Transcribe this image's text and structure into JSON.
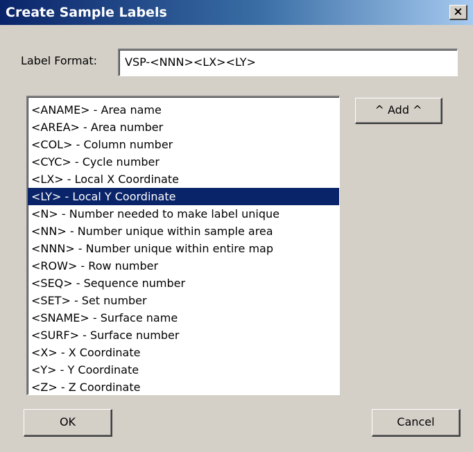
{
  "window": {
    "title": "Create Sample Labels",
    "close_glyph": "×",
    "close_icon": "close-icon"
  },
  "label_format": {
    "label": "Label Format:",
    "value": "VSP-<NNN><LX><LY>"
  },
  "token_list": {
    "selected_index": 5,
    "items": [
      "<ANAME> - Area name",
      "<AREA> - Area number",
      "<COL> - Column number",
      "<CYC> - Cycle number",
      "<LX> - Local X Coordinate",
      "<LY> - Local Y Coordinate",
      "<N> - Number needed to make label unique",
      "<NN> - Number unique within sample area",
      "<NNN> - Number unique within entire map",
      "<ROW> - Row number",
      "<SEQ> - Sequence number",
      "<SET> - Set number",
      "<SNAME> - Surface name",
      "<SURF> - Surface number",
      "<X> - X Coordinate",
      "<Y> - Y Coordinate",
      "<Z> - Z Coordinate"
    ]
  },
  "buttons": {
    "add_label": "^ Add ^",
    "ok_label": "OK",
    "cancel_label": "Cancel"
  },
  "colors": {
    "title_bar_start": "#0a246a",
    "title_bar_end": "#a6caf0",
    "selection": "#0a246a",
    "dialog_face": "#d4d0c8"
  }
}
